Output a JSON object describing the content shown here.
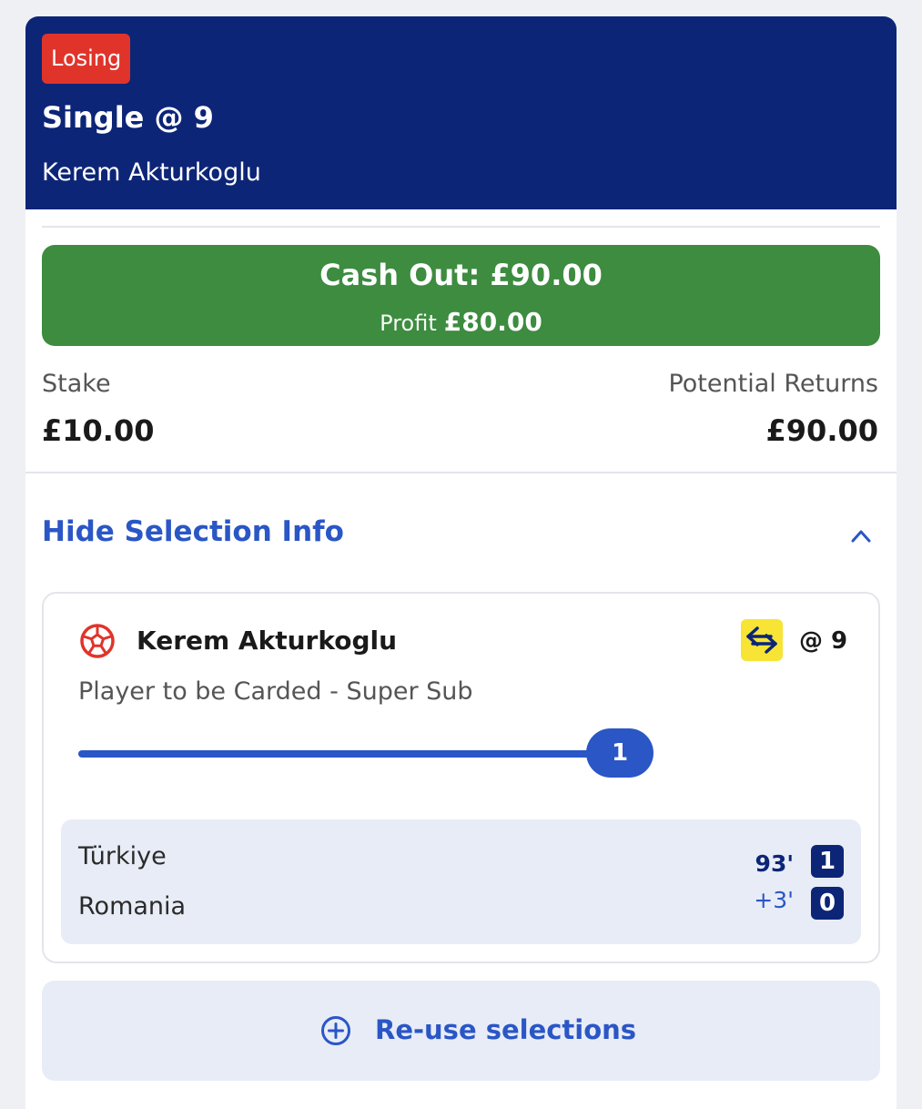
{
  "bet": {
    "status": "Losing",
    "title": "Single @ 9",
    "selection_name": "Kerem Akturkoglu"
  },
  "cashout": {
    "label": "Cash Out: £90.00",
    "profit_label": "Profit",
    "profit_value": "£80.00"
  },
  "stake": {
    "label": "Stake",
    "value": "£10.00"
  },
  "returns": {
    "label": "Potential Returns",
    "value": "£90.00"
  },
  "selection_info": {
    "toggle_label": "Hide Selection Info",
    "player": "Kerem Akturkoglu",
    "odds": "@ 9",
    "market": "Player to be Carded - Super Sub",
    "progress_value": "1",
    "progress_fraction": 1
  },
  "match": {
    "home_team": "Türkiye",
    "away_team": "Romania",
    "time": "93'",
    "added_time": "+3'",
    "home_score": "1",
    "away_score": "0"
  },
  "actions": {
    "reuse_label": "Re-use selections"
  },
  "colors": {
    "header": "#0c2577",
    "status_losing": "#e0342b",
    "cashout": "#3d8c40",
    "accent": "#2a56c6",
    "swap_badge": "#f7e435"
  },
  "icons": [
    "football-icon",
    "swap-icon",
    "chevron-up-icon",
    "plus-circle-icon"
  ]
}
